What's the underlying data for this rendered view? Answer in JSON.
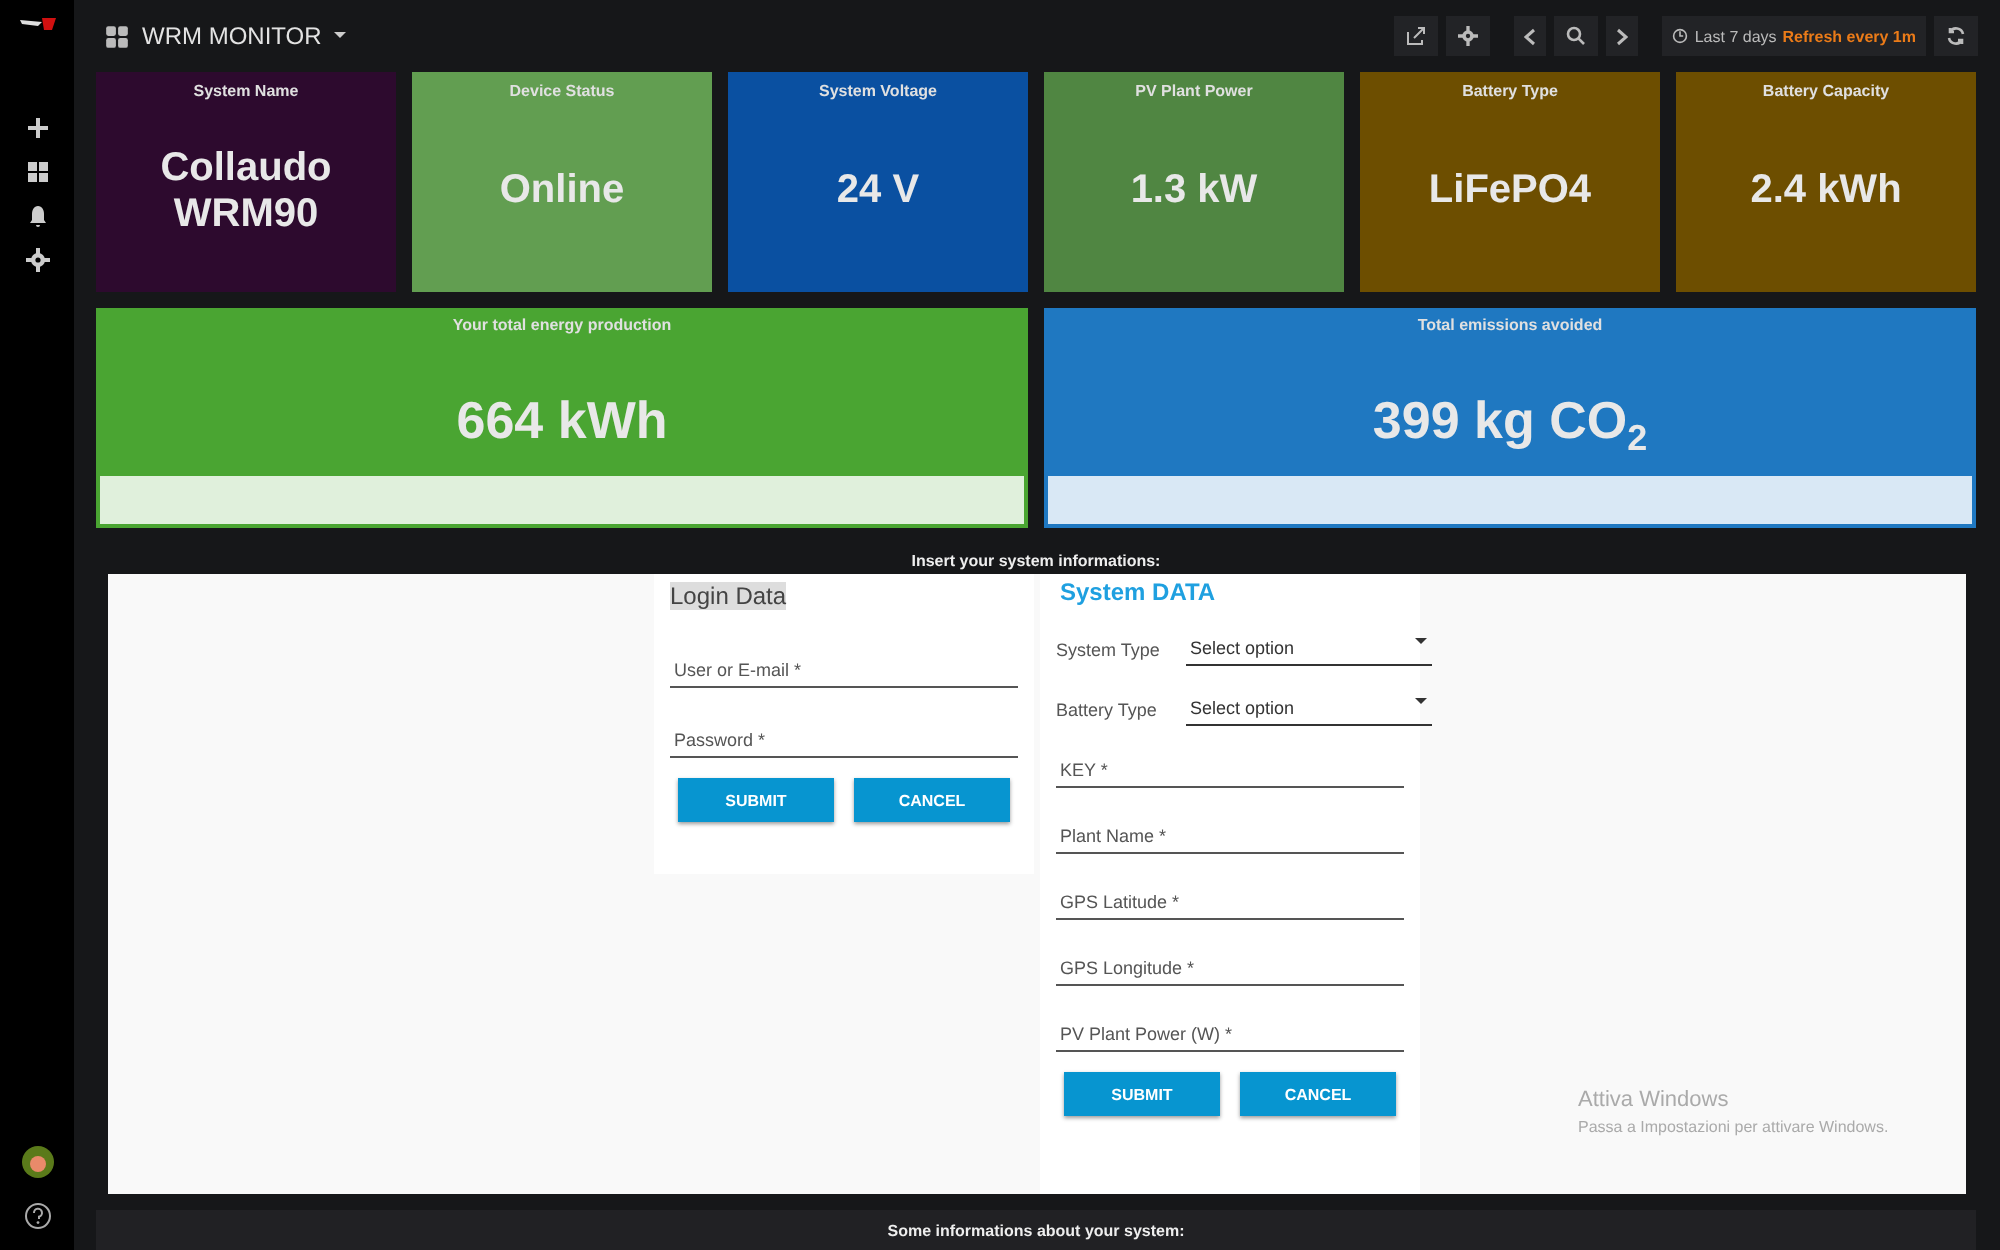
{
  "dashboard": {
    "title": "WRM MONITOR"
  },
  "toolbar": {
    "time_range": "Last 7 days",
    "refresh": "Refresh every 1m"
  },
  "stat_panels": [
    {
      "title": "System Name",
      "value": "Collaudo WRM90",
      "color": "#2d0a2e"
    },
    {
      "title": "Device Status",
      "value": "Online",
      "color": "#629e51"
    },
    {
      "title": "System Voltage",
      "value": "24 V",
      "color": "#0a50a1"
    },
    {
      "title": "PV Plant Power",
      "value": "1.3 kW",
      "color": "#508642"
    },
    {
      "title": "Battery Type",
      "value": "LiFePO4",
      "color": "#6d4e00"
    },
    {
      "title": "Battery Capacity",
      "value": "2.4 kWh",
      "color": "#6d4e00"
    }
  ],
  "total_panels": [
    {
      "title": "Your total energy production",
      "value": "664 kWh",
      "color": "#4aa532"
    },
    {
      "title": "Total emissions avoided",
      "value": "399 kg CO$_{2}$",
      "color": "#1f78c1"
    }
  ],
  "form_panel": {
    "title": "Insert your system informations:",
    "login": {
      "heading": "Login Data",
      "fields": [
        {
          "placeholder": "User or E-mail *"
        },
        {
          "placeholder": "Password *"
        }
      ],
      "buttons": [
        "SUBMIT",
        "CANCEL"
      ]
    },
    "system": {
      "heading": "System DATA",
      "selects": [
        {
          "label": "System Type",
          "value": "Select option"
        },
        {
          "label": "Battery Type",
          "value": "Select option"
        }
      ],
      "fields": [
        {
          "placeholder": "KEY *"
        },
        {
          "placeholder": "Plant Name *"
        },
        {
          "placeholder": "GPS Latitude *"
        },
        {
          "placeholder": "GPS Longitude *"
        },
        {
          "placeholder": "PV Plant Power (W) *"
        }
      ],
      "buttons": [
        "SUBMIT",
        "CANCEL"
      ]
    },
    "os_notice": {
      "title": "Attiva Windows",
      "text": "Passa a Impostazioni per attivare Windows."
    }
  },
  "info_panel": {
    "title": "Some informations about your system:"
  }
}
